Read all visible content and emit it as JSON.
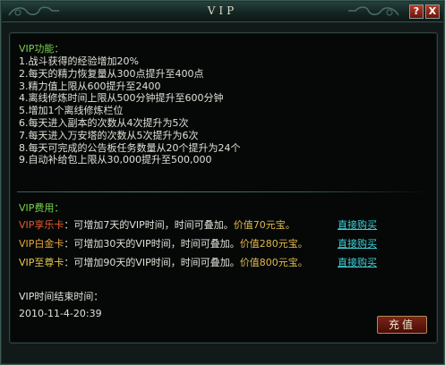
{
  "window": {
    "title": "VIP",
    "help_label": "?",
    "close_label": "X"
  },
  "features": {
    "title": "VIP功能：",
    "items": [
      "1.战斗获得的经验增加20%",
      "2.每天的精力恢复量从300点提升至400点",
      "3.精力值上限从600提升至2400",
      "4.离线修炼时间上限从500分钟提升至600分钟",
      "5.增加1个离线修炼栏位",
      "6.每天进入副本的次数从4次提升为5次",
      "7.每天进入万安塔的次数从5次提升为6次",
      "8.每天可完成的公告板任务数量从20个提升为24个",
      "9.自动补给包上限从30,000提升至500,000"
    ]
  },
  "fees": {
    "title": "VIP费用：",
    "cards": [
      {
        "name": "VIP享乐卡",
        "desc": "：可增加7天的VIP时间，时间可叠加。",
        "price": "价值70元宝。",
        "buy": "直接购买",
        "color": "#e85a2a"
      },
      {
        "name": "VIP白金卡",
        "desc": "：可增加30天的VIP时间，时间可叠加。",
        "price": "价值280元宝。",
        "buy": "直接购买",
        "color": "#e8a43a"
      },
      {
        "name": "VIP至尊卡",
        "desc": "：可增加90天的VIP时间，时间可叠加。",
        "price": "价值800元宝。",
        "buy": "直接购买",
        "color": "#e8c84a"
      }
    ]
  },
  "end_time": {
    "label": "VIP时间结束时间：",
    "value": "2010-11-4-20:39"
  },
  "actions": {
    "recharge_label": "充值"
  }
}
